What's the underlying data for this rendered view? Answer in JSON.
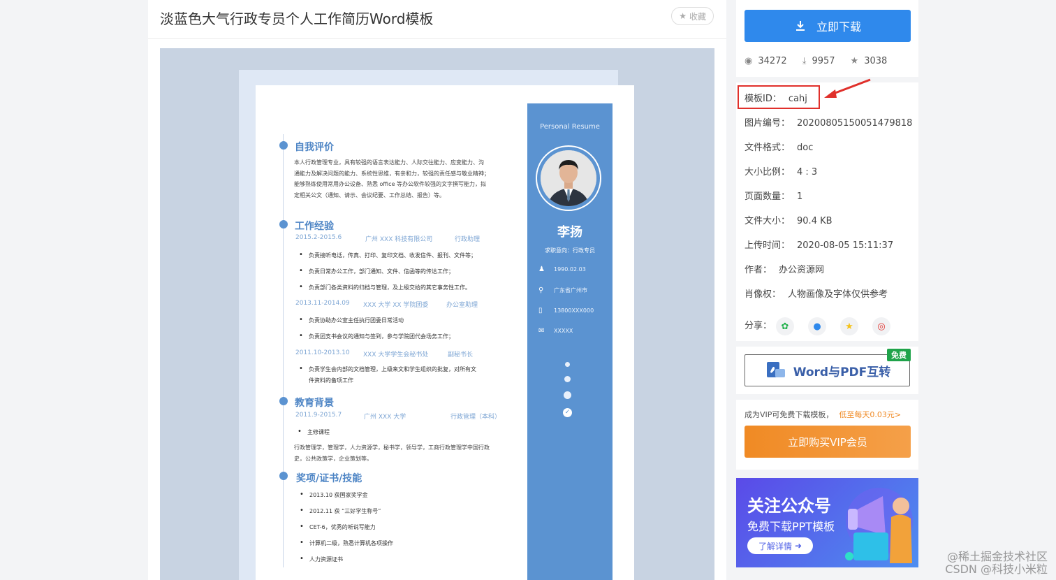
{
  "page": {
    "title": "淡蓝色大气行政专员个人工作简历Word模板",
    "fav_label": "收藏"
  },
  "resume": {
    "side_header": "Personal Resume",
    "name": "李扬",
    "intent": "求职意向：行政专员",
    "birth": "1990.02.03",
    "location": "广东省广州市",
    "phone": "13800XXX000",
    "email": "XXXXX",
    "sections": {
      "self": {
        "title": "自我评价",
        "text": "本人行政管理专业，具有较强的语言表达能力、人际交往能力、应变能力、沟\n通能力及解决问题的能力、系统性思维，有亲和力，较强的责任感与敬业精神；\n能够熟练使用常用办公设备、熟悉 office 等办公软件较强的文字撰写能力，拟\n定相关公文（通知、请示、会议纪要、工作总结、报告）等。"
      },
      "work": {
        "title": "工作经验",
        "jobs": [
          {
            "period": "2015.2-2015.6",
            "org": "广州 XXX 科技有限公司",
            "role": "行政助理",
            "items": [
              "负责接听电话，传真、打印、复印文档、收发信件、报刊、文件等；",
              "负责日常办公工作，部门通知、文件、信函等的传达工作；",
              "负责部门各类资料的归档与管理，及上级交给的其它事务性工作。"
            ]
          },
          {
            "period": "2013.11-2014.09",
            "org": "XXX 大学 XX 学院团委",
            "role": "办公室助理",
            "items": [
              "负责协助办公室主任执行团委日常活动",
              "负责团支书会议的通知与签到，参与学院团代会场务工作；"
            ]
          },
          {
            "period": "2011.10-2013.10",
            "org": "XXX 大学学生会秘书处",
            "role": "副秘书长",
            "items": [
              "负责学生会内部的文档管理，上级来文和学生组织的批复，对所有文\n件资料的备项工作"
            ]
          }
        ]
      },
      "edu": {
        "title": "教育背景",
        "period": "2011.9-2015.7",
        "school": "广州 XXX 大学",
        "major": "行政管理（本科）",
        "course_label": "主修课程",
        "courses": "行政管理学，管理学，人力资源学，秘书学，领导学，工商行政管理学中国行政\n史，公共政策学，企业策划等。"
      },
      "awards": {
        "title": "奖项/证书/技能",
        "items": [
          "2013.10 获国家奖学金",
          "2012.11 获 “三好学生称号”",
          "CET-6，优秀的听说写能力",
          "计算机二级，熟悉计算机各项操作",
          "人力资源证书"
        ]
      }
    }
  },
  "sidebar": {
    "download_label": "立即下载",
    "stats": {
      "views": "34272",
      "downloads": "9957",
      "favorites": "3038"
    },
    "info": [
      {
        "key": "模板ID：",
        "value": "cahj"
      },
      {
        "key": "图片编号：",
        "value": "20200805150051479818"
      },
      {
        "key": "文件格式：",
        "value": "doc"
      },
      {
        "key": "大小比例：",
        "value": "4 : 3"
      },
      {
        "key": "页面数量：",
        "value": "1"
      },
      {
        "key": "文件大小：",
        "value": "90.4 KB"
      },
      {
        "key": "上传时间：",
        "value": "2020-08-05 15:11:37"
      },
      {
        "key": "作者：",
        "value": "办公资源网"
      },
      {
        "key": "肖像权：",
        "value": "人物画像及字体仅供参考"
      }
    ],
    "share_label": "分享：",
    "convert_label": "Word与PDF互转",
    "free_badge": "免费",
    "vip_note": "成为VIP可免费下载模板，",
    "vip_cheap": "低至每天0.03元>",
    "vip_button": "立即购买VIP会员",
    "banner_title": "关注公众号",
    "banner_sub": "免费下载PPT模板",
    "banner_btn": "了解详情"
  },
  "watermark": {
    "line1": "@稀土掘金技术社区",
    "line2": "CSDN @科技小米粒"
  },
  "colors": {
    "accent_blue": "#2f89ec",
    "resume_blue": "#5b93d1",
    "vip_orange": "#f08a24",
    "highlight_red": "#e0302b"
  }
}
